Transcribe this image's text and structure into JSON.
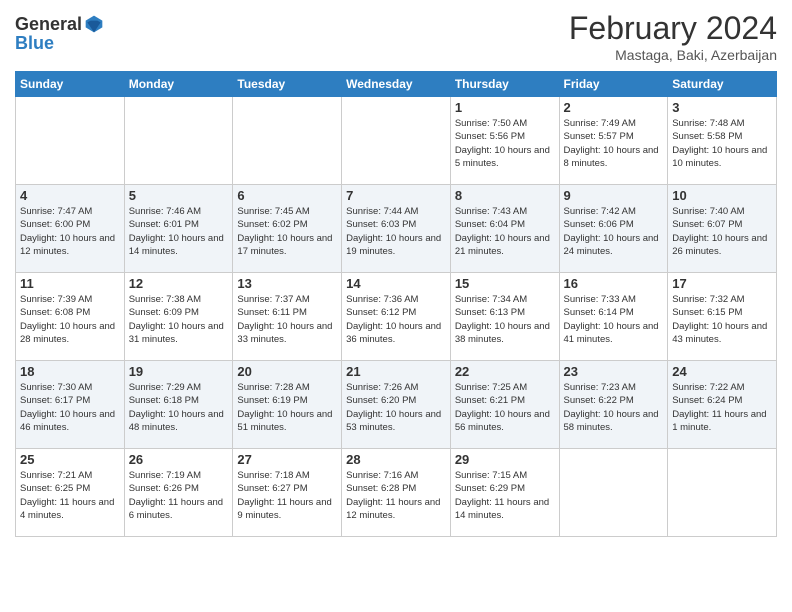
{
  "header": {
    "logo_general": "General",
    "logo_blue": "Blue",
    "month_title": "February 2024",
    "location": "Mastaga, Baki, Azerbaijan"
  },
  "weekdays": [
    "Sunday",
    "Monday",
    "Tuesday",
    "Wednesday",
    "Thursday",
    "Friday",
    "Saturday"
  ],
  "weeks": [
    [
      {
        "day": "",
        "info": ""
      },
      {
        "day": "",
        "info": ""
      },
      {
        "day": "",
        "info": ""
      },
      {
        "day": "",
        "info": ""
      },
      {
        "day": "1",
        "info": "Sunrise: 7:50 AM\nSunset: 5:56 PM\nDaylight: 10 hours and 5 minutes."
      },
      {
        "day": "2",
        "info": "Sunrise: 7:49 AM\nSunset: 5:57 PM\nDaylight: 10 hours and 8 minutes."
      },
      {
        "day": "3",
        "info": "Sunrise: 7:48 AM\nSunset: 5:58 PM\nDaylight: 10 hours and 10 minutes."
      }
    ],
    [
      {
        "day": "4",
        "info": "Sunrise: 7:47 AM\nSunset: 6:00 PM\nDaylight: 10 hours and 12 minutes."
      },
      {
        "day": "5",
        "info": "Sunrise: 7:46 AM\nSunset: 6:01 PM\nDaylight: 10 hours and 14 minutes."
      },
      {
        "day": "6",
        "info": "Sunrise: 7:45 AM\nSunset: 6:02 PM\nDaylight: 10 hours and 17 minutes."
      },
      {
        "day": "7",
        "info": "Sunrise: 7:44 AM\nSunset: 6:03 PM\nDaylight: 10 hours and 19 minutes."
      },
      {
        "day": "8",
        "info": "Sunrise: 7:43 AM\nSunset: 6:04 PM\nDaylight: 10 hours and 21 minutes."
      },
      {
        "day": "9",
        "info": "Sunrise: 7:42 AM\nSunset: 6:06 PM\nDaylight: 10 hours and 24 minutes."
      },
      {
        "day": "10",
        "info": "Sunrise: 7:40 AM\nSunset: 6:07 PM\nDaylight: 10 hours and 26 minutes."
      }
    ],
    [
      {
        "day": "11",
        "info": "Sunrise: 7:39 AM\nSunset: 6:08 PM\nDaylight: 10 hours and 28 minutes."
      },
      {
        "day": "12",
        "info": "Sunrise: 7:38 AM\nSunset: 6:09 PM\nDaylight: 10 hours and 31 minutes."
      },
      {
        "day": "13",
        "info": "Sunrise: 7:37 AM\nSunset: 6:11 PM\nDaylight: 10 hours and 33 minutes."
      },
      {
        "day": "14",
        "info": "Sunrise: 7:36 AM\nSunset: 6:12 PM\nDaylight: 10 hours and 36 minutes."
      },
      {
        "day": "15",
        "info": "Sunrise: 7:34 AM\nSunset: 6:13 PM\nDaylight: 10 hours and 38 minutes."
      },
      {
        "day": "16",
        "info": "Sunrise: 7:33 AM\nSunset: 6:14 PM\nDaylight: 10 hours and 41 minutes."
      },
      {
        "day": "17",
        "info": "Sunrise: 7:32 AM\nSunset: 6:15 PM\nDaylight: 10 hours and 43 minutes."
      }
    ],
    [
      {
        "day": "18",
        "info": "Sunrise: 7:30 AM\nSunset: 6:17 PM\nDaylight: 10 hours and 46 minutes."
      },
      {
        "day": "19",
        "info": "Sunrise: 7:29 AM\nSunset: 6:18 PM\nDaylight: 10 hours and 48 minutes."
      },
      {
        "day": "20",
        "info": "Sunrise: 7:28 AM\nSunset: 6:19 PM\nDaylight: 10 hours and 51 minutes."
      },
      {
        "day": "21",
        "info": "Sunrise: 7:26 AM\nSunset: 6:20 PM\nDaylight: 10 hours and 53 minutes."
      },
      {
        "day": "22",
        "info": "Sunrise: 7:25 AM\nSunset: 6:21 PM\nDaylight: 10 hours and 56 minutes."
      },
      {
        "day": "23",
        "info": "Sunrise: 7:23 AM\nSunset: 6:22 PM\nDaylight: 10 hours and 58 minutes."
      },
      {
        "day": "24",
        "info": "Sunrise: 7:22 AM\nSunset: 6:24 PM\nDaylight: 11 hours and 1 minute."
      }
    ],
    [
      {
        "day": "25",
        "info": "Sunrise: 7:21 AM\nSunset: 6:25 PM\nDaylight: 11 hours and 4 minutes."
      },
      {
        "day": "26",
        "info": "Sunrise: 7:19 AM\nSunset: 6:26 PM\nDaylight: 11 hours and 6 minutes."
      },
      {
        "day": "27",
        "info": "Sunrise: 7:18 AM\nSunset: 6:27 PM\nDaylight: 11 hours and 9 minutes."
      },
      {
        "day": "28",
        "info": "Sunrise: 7:16 AM\nSunset: 6:28 PM\nDaylight: 11 hours and 12 minutes."
      },
      {
        "day": "29",
        "info": "Sunrise: 7:15 AM\nSunset: 6:29 PM\nDaylight: 11 hours and 14 minutes."
      },
      {
        "day": "",
        "info": ""
      },
      {
        "day": "",
        "info": ""
      }
    ]
  ]
}
